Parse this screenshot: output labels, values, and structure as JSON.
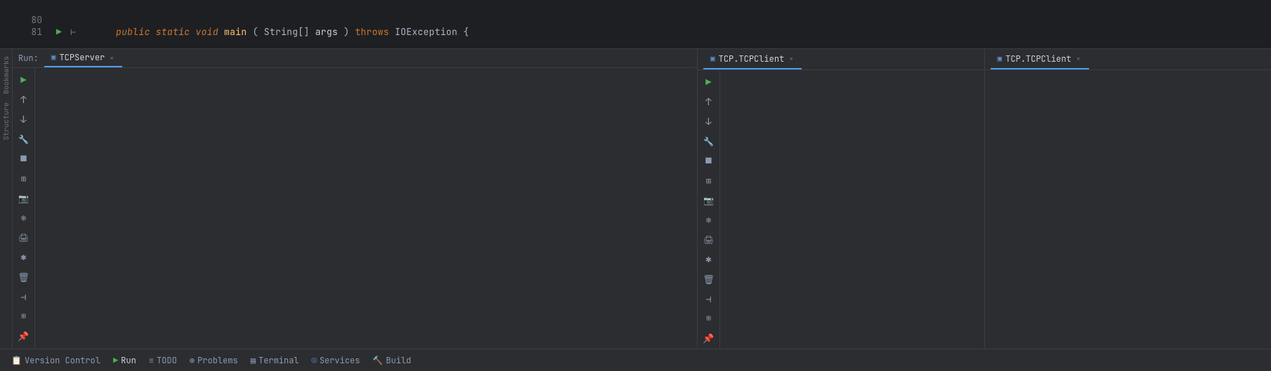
{
  "code": {
    "line80": "80",
    "line81": "81",
    "code_text_italic_public": "public",
    "code_text_italic_static": "static",
    "code_text_italic_void": "void",
    "method": "main",
    "params": "(String[] args)",
    "throws_kw": "throws",
    "exception": "IOException",
    "brace": "{"
  },
  "run_label": "Run:",
  "panels": {
    "left": {
      "tab_icon": "▣",
      "tab_name": "TCPServer",
      "tab_close": "×"
    },
    "right1": {
      "tab_icon": "▣",
      "tab_name": "TCP.TCPClient",
      "tab_close": "×"
    },
    "right2": {
      "tab_icon": "▣",
      "tab_name": "TCP.TCPClient",
      "tab_close": "×"
    }
  },
  "toolbar": {
    "buttons": [
      {
        "icon": "▶",
        "name": "run",
        "color": "green"
      },
      {
        "icon": "↑",
        "name": "up"
      },
      {
        "icon": "↓",
        "name": "down"
      },
      {
        "icon": "🔧",
        "name": "wrench"
      },
      {
        "icon": "■",
        "name": "stop"
      },
      {
        "icon": "⊞",
        "name": "restore-layout"
      },
      {
        "icon": "⊕",
        "name": "camera"
      },
      {
        "icon": "❄",
        "name": "freeze"
      },
      {
        "icon": "🖨",
        "name": "print"
      },
      {
        "icon": "✱",
        "name": "asterisk"
      },
      {
        "icon": "🗑",
        "name": "delete"
      },
      {
        "icon": "⊣",
        "name": "close-active"
      },
      {
        "icon": "⊞",
        "name": "layout2"
      },
      {
        "icon": "📌",
        "name": "pin"
      }
    ]
  },
  "side_tabs": {
    "bookmarks": "Bookmarks",
    "structure": "Structure"
  },
  "bottom_tabs": [
    {
      "icon": "📋",
      "label": "Version Control",
      "icon_type": "default"
    },
    {
      "icon": "▶",
      "label": "Run",
      "icon_type": "green"
    },
    {
      "icon": "≡",
      "label": "TODO",
      "icon_type": "default"
    },
    {
      "icon": "⊕",
      "label": "Problems",
      "icon_type": "default"
    },
    {
      "icon": "▤",
      "label": "Terminal",
      "icon_type": "default"
    },
    {
      "icon": "◎",
      "label": "Services",
      "icon_type": "blue"
    },
    {
      "icon": "🔨",
      "label": "Build",
      "icon_type": "default"
    }
  ]
}
